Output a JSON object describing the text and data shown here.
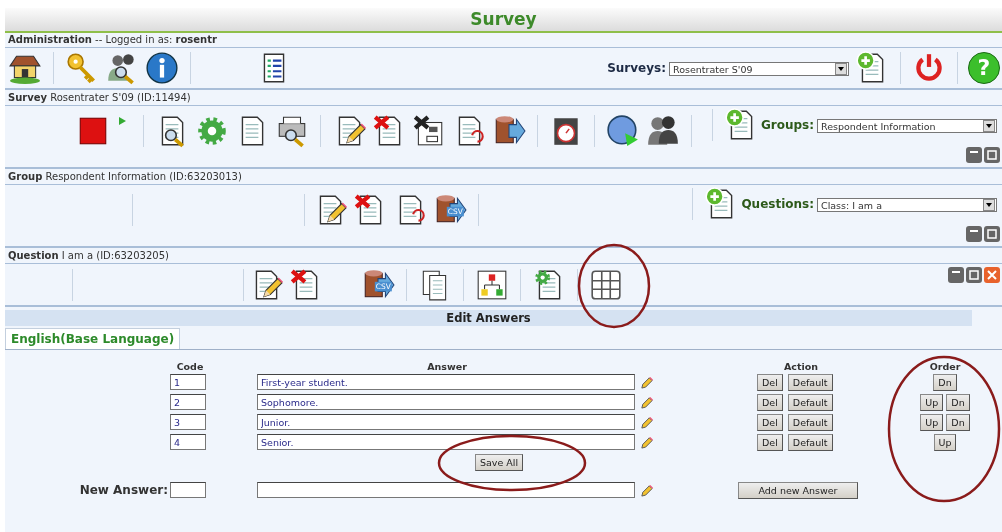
{
  "title": "Survey",
  "admin": {
    "header": "**Administration** -- Logged in as: **rosentr**",
    "surveys_label": "Surveys:",
    "surveys_value": "Rosentrater S'09",
    "help_glyph": "?"
  },
  "survey": {
    "header": "**Survey** Rosentrater S'09 (ID:11494)",
    "groups_label": "Groups:",
    "groups_value": "Respondent Information"
  },
  "group": {
    "header": "**Group** Respondent Information (ID:63203013)",
    "questions_label": "Questions:",
    "questions_value": "Class: I am a",
    "csv_label": "CSV"
  },
  "question": {
    "header": "**Question** I am a (ID:63203205)",
    "csv_label": "CSV"
  },
  "edit_answers": {
    "title": "Edit Answers",
    "tabs": [
      {
        "label": "English(Base Language)",
        "selected": true
      }
    ],
    "columns": [
      "Code",
      "Answer",
      "Action",
      "Order"
    ],
    "rows": [
      {
        "code": "1",
        "answer": "First-year student.",
        "actions": [
          "Del",
          "Default"
        ],
        "order": [
          "Dn"
        ]
      },
      {
        "code": "2",
        "answer": "Sophomore.",
        "actions": [
          "Del",
          "Default"
        ],
        "order": [
          "Up",
          "Dn"
        ]
      },
      {
        "code": "3",
        "answer": "Junior.",
        "actions": [
          "Del",
          "Default"
        ],
        "order": [
          "Up",
          "Dn"
        ]
      },
      {
        "code": "4",
        "answer": "Senior.",
        "actions": [
          "Del",
          "Default"
        ],
        "order": [
          "Up"
        ]
      }
    ],
    "save_button": "Save All",
    "new_answer": {
      "label": "New Answer:",
      "button": "Add new Answer"
    }
  }
}
